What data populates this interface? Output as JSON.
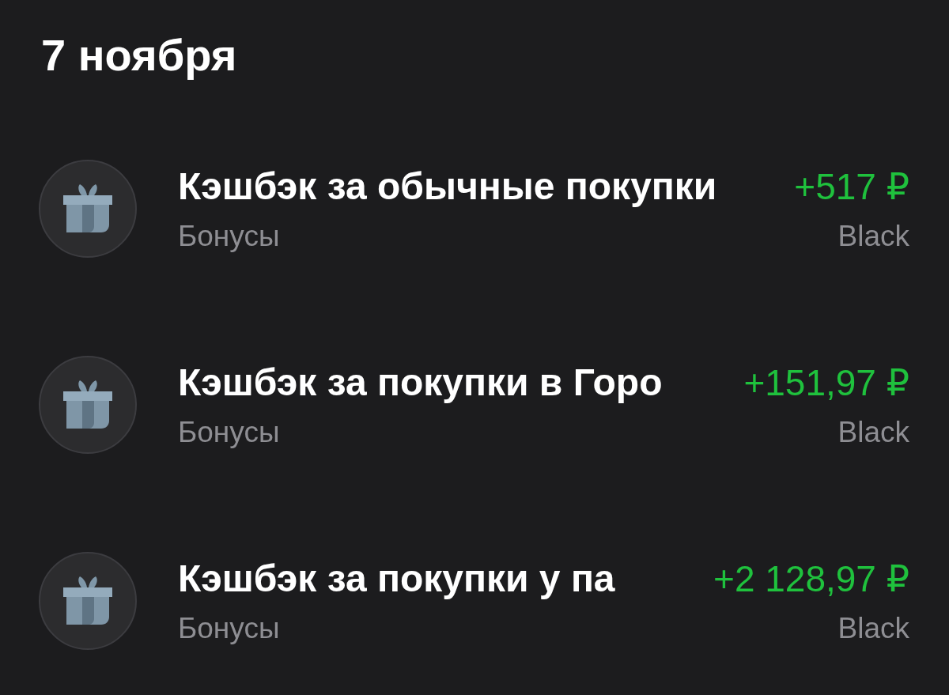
{
  "date_header": "7 ноября",
  "transactions": [
    {
      "title": "Кэшбэк за обычные покупки",
      "category": "Бонусы",
      "amount": "+517 ₽",
      "account": "Black"
    },
    {
      "title": "Кэшбэк за покупки в Горо",
      "category": "Бонусы",
      "amount": "+151,97 ₽",
      "account": "Black"
    },
    {
      "title": "Кэшбэк за покупки у па",
      "category": "Бонусы",
      "amount": "+2 128,97 ₽",
      "account": "Black"
    }
  ]
}
